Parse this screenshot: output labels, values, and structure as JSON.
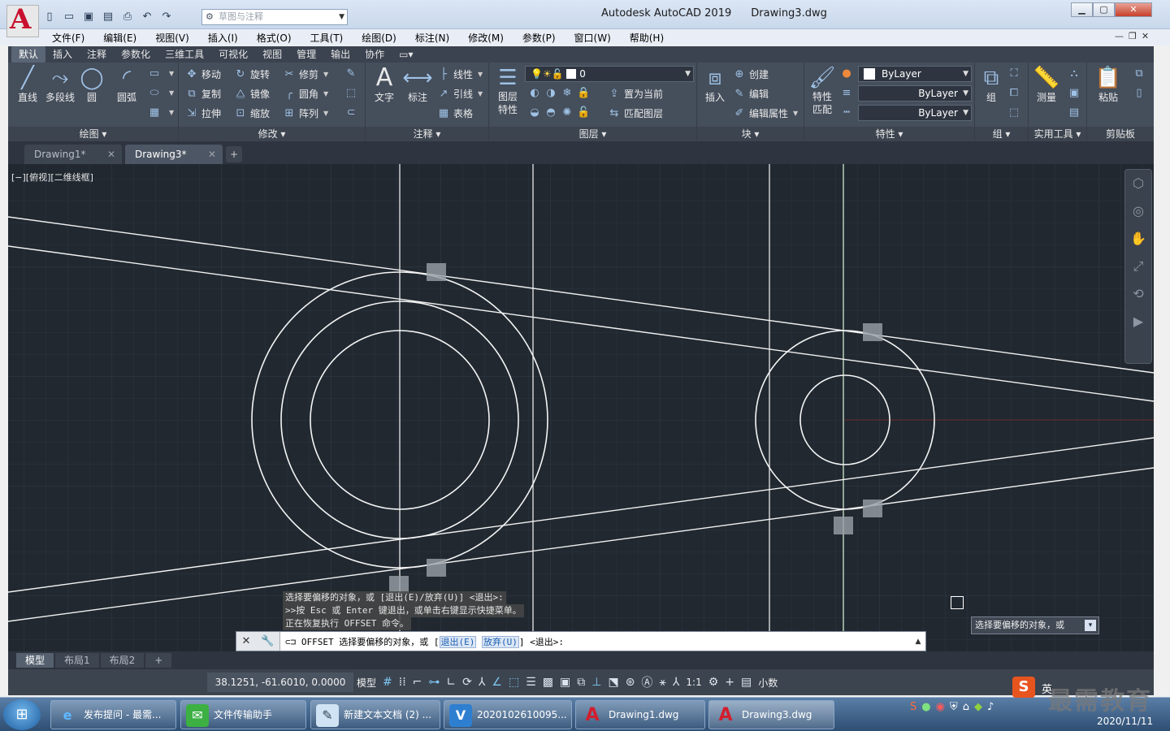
{
  "app": {
    "logo_letter": "A",
    "title": "Autodesk AutoCAD 2019",
    "file": "Drawing3.dwg",
    "workspace_placeholder": "草图与注释",
    "win_min": "▁",
    "win_max": "▢",
    "win_close": "✕"
  },
  "menubar": [
    "文件(F)",
    "编辑(E)",
    "视图(V)",
    "插入(I)",
    "格式(O)",
    "工具(T)",
    "绘图(D)",
    "标注(N)",
    "修改(M)",
    "参数(P)",
    "窗口(W)",
    "帮助(H)"
  ],
  "ribbon_tabs": [
    "默认",
    "插入",
    "注释",
    "参数化",
    "三维工具",
    "可视化",
    "视图",
    "管理",
    "输出",
    "协作"
  ],
  "ribbon": {
    "draw": {
      "title": "绘图",
      "line": "直线",
      "polyline": "多段线",
      "circle": "圆",
      "arc": "圆弧"
    },
    "modify": {
      "title": "修改",
      "move": "移动",
      "rotate": "旋转",
      "trim": "修剪",
      "copy": "复制",
      "mirror": "镜像",
      "fillet": "圆角",
      "stretch": "拉伸",
      "scale": "缩放",
      "array": "阵列"
    },
    "annotation": {
      "title": "注释",
      "text": "文字",
      "dimension": "标注",
      "linear": "线性",
      "leader": "引线",
      "table": "表格"
    },
    "layers": {
      "title": "图层",
      "props": "图层\n特性",
      "current_layer": "0",
      "set_current": "置为当前",
      "match_layer": "匹配图层"
    },
    "block": {
      "title": "块",
      "insert": "插入",
      "create": "创建",
      "edit": "编辑",
      "edit_attr": "编辑属性"
    },
    "properties": {
      "title": "特性",
      "match": "特性\n匹配",
      "color": "ByLayer",
      "linetype": "ByLayer",
      "lineweight": "ByLayer"
    },
    "groups": {
      "title": "组",
      "group": "组"
    },
    "utilities": {
      "title": "实用工具",
      "measure": "测量"
    },
    "clipboard": {
      "title": "剪贴板",
      "paste": "粘贴"
    }
  },
  "doc_tabs": [
    "Drawing1*",
    "Drawing3*"
  ],
  "viewport_label": "[−][俯视][二维线框]",
  "command_history": [
    "选择要偏移的对象，或 [退出(E)/放弃(U)] <退出>:",
    ">>按 Esc 或 Enter 键退出，或单击右键显示快捷菜单。",
    "正在恢复执行 OFFSET 命令。"
  ],
  "command_line": {
    "cmd": "OFFSET",
    "prompt": "选择要偏移的对象，或 [",
    "opt1": "退出(E)",
    "opt2": "放弃(U)",
    "suffix": "] <退出>:"
  },
  "tooltip": "选择要偏移的对象，或",
  "layout_tabs": [
    "模型",
    "布局1",
    "布局2"
  ],
  "status": {
    "coords": "38.1251, -61.6010, 0.0000",
    "model": "模型",
    "scale": "1:1",
    "units": "小数"
  },
  "taskbar": {
    "items": [
      "发布提问 - 最需...",
      "文件传输助手",
      "新建文本文档 (2) ...",
      "2020102610095...",
      "Drawing1.dwg",
      "Drawing3.dwg"
    ],
    "date": "2020/11/11",
    "ime": "英"
  },
  "watermark": "最需教育",
  "colors": {
    "canvas": "#212830",
    "ribbon": "#454e5b",
    "accent": "#7ec6f2",
    "close": "#c7402b"
  }
}
